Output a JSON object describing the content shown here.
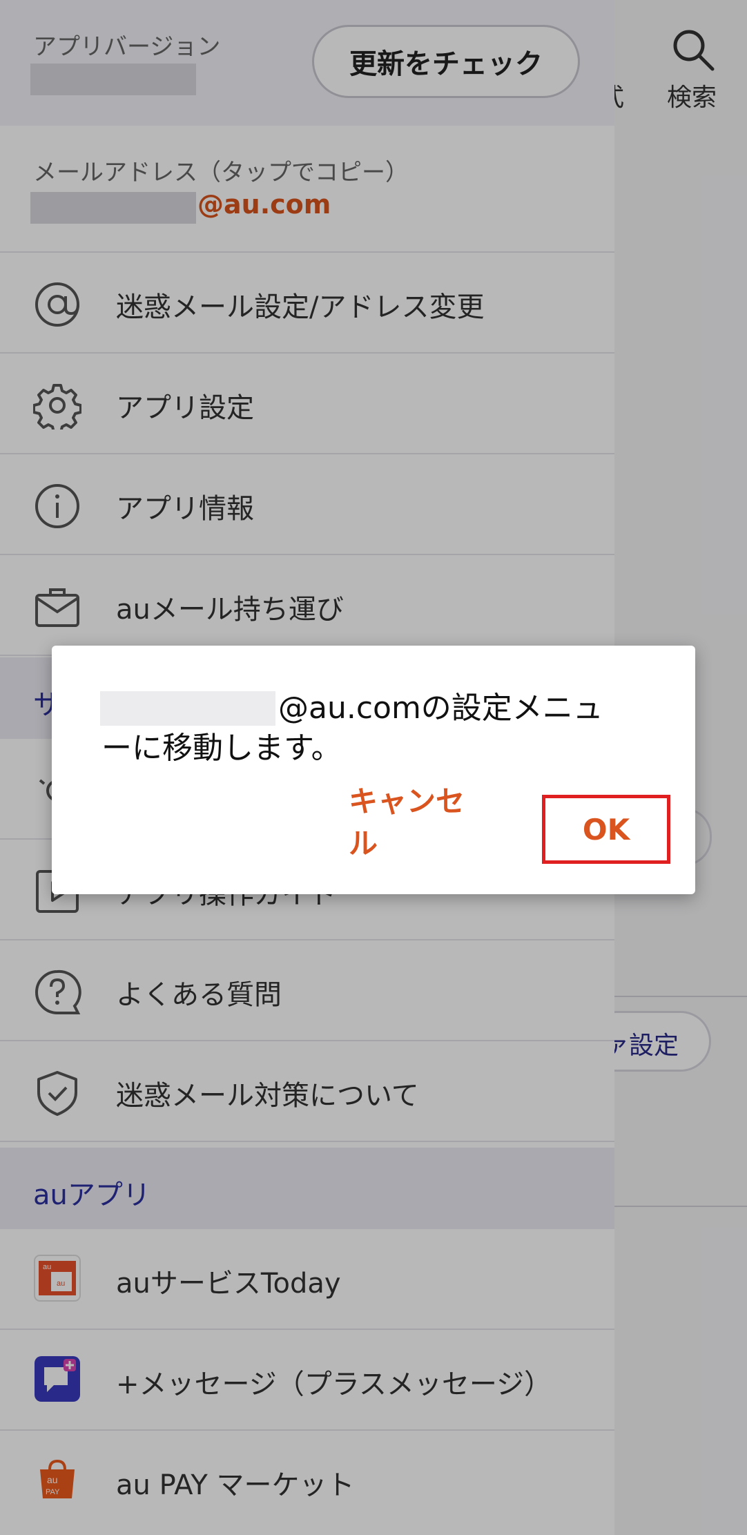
{
  "background": {
    "search_label": "検索",
    "status_fragment": "式",
    "top_fragment": "？",
    "pill_fragment": "ァ設定"
  },
  "drawer": {
    "app_version_label": "アプリバージョン",
    "update_button": "更新をチェック",
    "email_label": "メールアドレス（タップでコピー）",
    "email_domain": "@au.com",
    "menu": [
      {
        "label": "迷惑メール設定/アドレス変更",
        "icon": "at-icon"
      },
      {
        "label": "アプリ設定",
        "icon": "gear-icon"
      },
      {
        "label": "アプリ情報",
        "icon": "info-icon"
      },
      {
        "label": "auメール持ち運び",
        "icon": "briefcase-icon"
      }
    ],
    "support_section": "サポート",
    "support_items": [
      {
        "label": "",
        "icon": "bulb-icon"
      },
      {
        "label": "アプリ操作ガイド",
        "icon": "play-icon"
      },
      {
        "label": "よくある質問",
        "icon": "question-icon"
      },
      {
        "label": "迷惑メール対策について",
        "icon": "shield-icon"
      }
    ],
    "au_apps_section": "auアプリ",
    "apps": [
      {
        "label": "auサービスToday",
        "icon": "au-service-today-icon"
      },
      {
        "label": "+メッセージ（プラスメッセージ）",
        "icon": "plus-message-icon"
      },
      {
        "label": "au PAY マーケット",
        "icon": "au-pay-market-icon"
      }
    ]
  },
  "dialog": {
    "message_line1": "@au.comの設定メニュ",
    "message_line2": "ーに移動します。",
    "cancel": "キャンセル",
    "ok": "OK"
  },
  "colors": {
    "accent": "#d9541e",
    "section_text": "#2b2f9e",
    "highlight_border": "#e02020"
  }
}
